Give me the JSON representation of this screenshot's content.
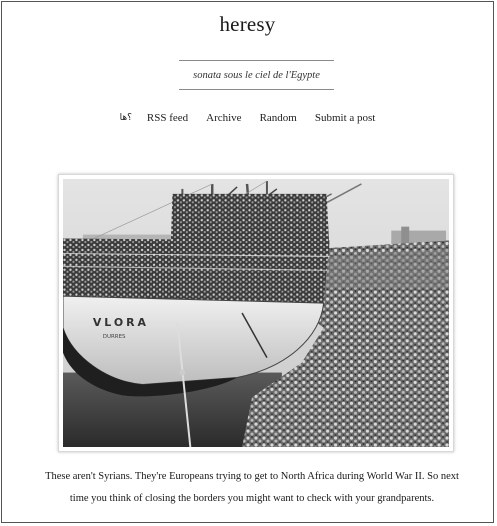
{
  "blog": {
    "title": "heresy",
    "subtitle": "sonata sous le ciel de l'Egypte"
  },
  "nav": {
    "ask_label": "؟ها",
    "items": [
      "RSS feed",
      "Archive",
      "Random",
      "Submit a post"
    ]
  },
  "post": {
    "photo_ship_name": "VLORA",
    "photo_port_name": "DURRES",
    "caption": "These aren't Syrians. They're Europeans trying to get to North Africa during World War II. So next time you think of closing the borders you might want to check with your grandparents."
  }
}
